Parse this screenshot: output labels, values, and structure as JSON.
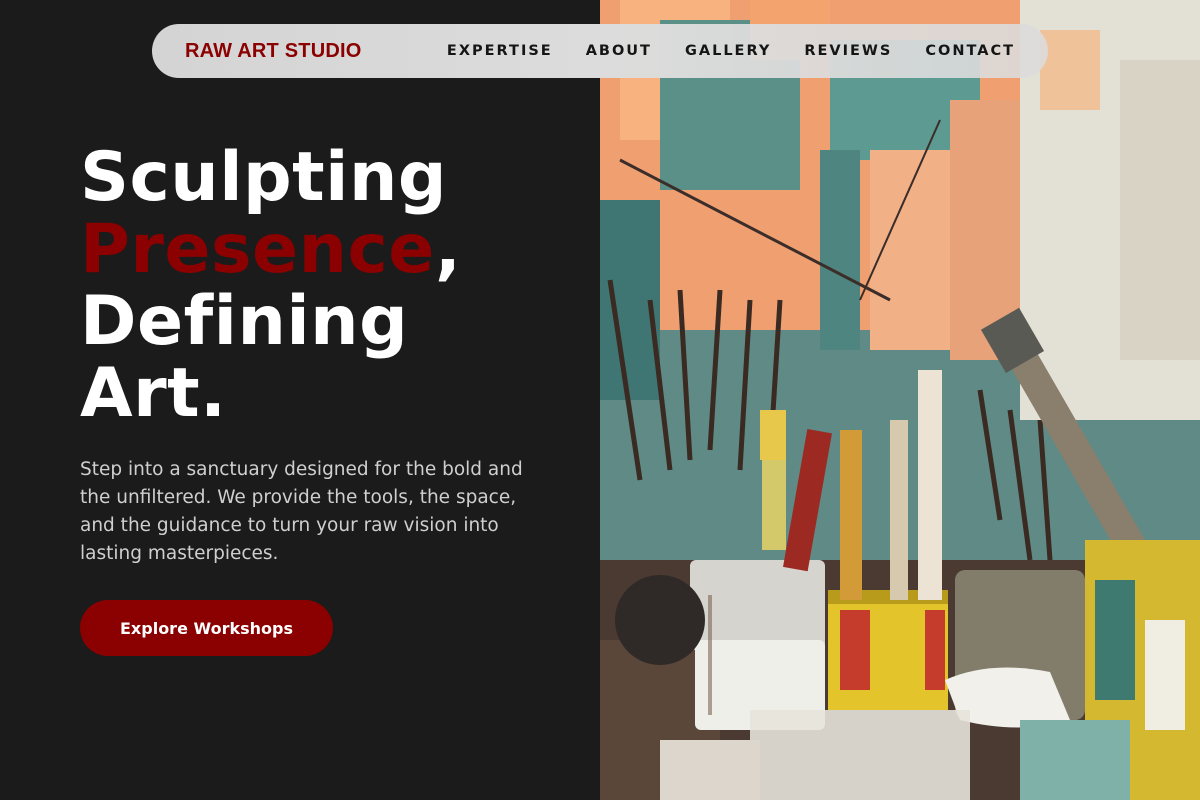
{
  "nav": {
    "brand": "RAW ART STUDIO",
    "links": [
      "EXPERTISE",
      "ABOUT",
      "GALLERY",
      "REVIEWS",
      "CONTACT"
    ]
  },
  "hero": {
    "headline_line1": "Sculpting",
    "headline_accent": "Presence",
    "headline_comma": ",",
    "headline_line3": "Defining",
    "headline_line4": "Art.",
    "description": "Step into a sanctuary designed for the bold and the unfiltered. We provide the tools, the space, and the guidance to turn your raw vision into lasting masterpieces.",
    "cta_label": "Explore Workshops",
    "image_label": "art studio brushes and paint cans"
  },
  "colors": {
    "accent": "#8b0000",
    "background": "#1b1b1b",
    "text": "#ffffff",
    "muted_text": "#cfcfcf"
  }
}
